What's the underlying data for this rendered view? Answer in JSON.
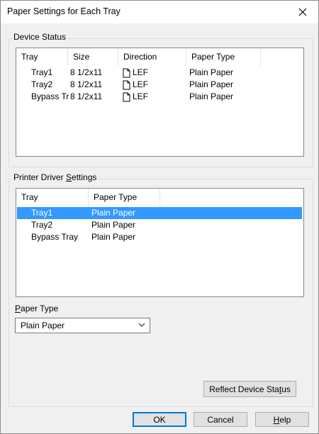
{
  "window": {
    "title": "Paper Settings for Each Tray",
    "close_icon": "close-icon"
  },
  "device_status": {
    "label": "Device Status",
    "columns": [
      "Tray",
      "Size",
      "Direction",
      "Paper Type"
    ],
    "rows": [
      {
        "tray": "Tray1",
        "size": "8 1/2x11",
        "direction": "LEF",
        "paper_type": "Plain Paper"
      },
      {
        "tray": "Tray2",
        "size": "8 1/2x11",
        "direction": "LEF",
        "paper_type": "Plain Paper"
      },
      {
        "tray": "Bypass Tra",
        "size": "8 1/2x11",
        "direction": "LEF",
        "paper_type": "Plain Paper"
      }
    ]
  },
  "driver_settings": {
    "label_prefix": "Printer Driver ",
    "label_accel": "S",
    "label_suffix": "ettings",
    "columns": [
      "Tray",
      "Paper Type"
    ],
    "rows": [
      {
        "tray": "Tray1",
        "paper_type": "Plain Paper",
        "selected": true
      },
      {
        "tray": "Tray2",
        "paper_type": "Plain Paper",
        "selected": false
      },
      {
        "tray": "Bypass Tray",
        "paper_type": "Plain Paper",
        "selected": false
      }
    ],
    "selected_color": "#3399ff"
  },
  "paper_type": {
    "label_accel": "P",
    "label_rest": "aper Type",
    "value": "Plain Paper"
  },
  "buttons": {
    "reflect_prefix": "Reflect Device Sta",
    "reflect_accel": "t",
    "reflect_suffix": "us",
    "ok": "OK",
    "cancel": "Cancel",
    "help_accel": "H",
    "help_rest": "elp"
  },
  "colors": {
    "default_button_border": "#0078d7",
    "window_bg": "#f0f0f0"
  }
}
